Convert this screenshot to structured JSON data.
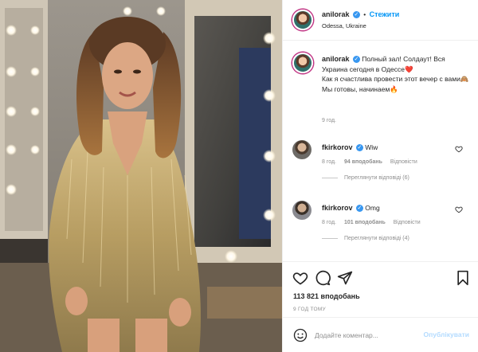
{
  "post": {
    "author": "anilorak",
    "follow_label": "Стежити",
    "location": "Odessa, Ukraine",
    "verified_mark": "✓",
    "more_label": "•••"
  },
  "caption": {
    "username": "anilorak",
    "lines": [
      "Полный зал! Солдаут! Вся Украина сегодня в Одессе❤️",
      "Как я счастлива провести этот вечер с вами🙈",
      "Мы готовы, начинаем🔥"
    ],
    "time": "9 год."
  },
  "comments": [
    {
      "username": "fkirkorov",
      "text": "Wiw",
      "time": "8 год.",
      "likes": "94 вподобань",
      "reply": "Відповісти",
      "view_replies": "Переглянути відповіді (6)"
    },
    {
      "username": "fkirkorov",
      "text": "Omg",
      "time": "8 год.",
      "likes": "101 вподобань",
      "reply": "Відповісти",
      "view_replies": "Переглянути відповіді (4)"
    }
  ],
  "actions": {
    "likes": "113 821 вподобань",
    "post_time": "9 ГОД ТОМУ"
  },
  "add_comment": {
    "placeholder": "Додайте коментар...",
    "publish_label": "Опублікувати"
  },
  "icons": {
    "like": "heart-icon",
    "comment": "comment-icon",
    "share": "send-icon",
    "save": "bookmark-icon",
    "emoji": "emoji-icon"
  },
  "colors": {
    "accent": "#0095f6",
    "verified": "#3897f0",
    "muted": "#8e8e8e",
    "publish_disabled": "#b3dbff"
  }
}
